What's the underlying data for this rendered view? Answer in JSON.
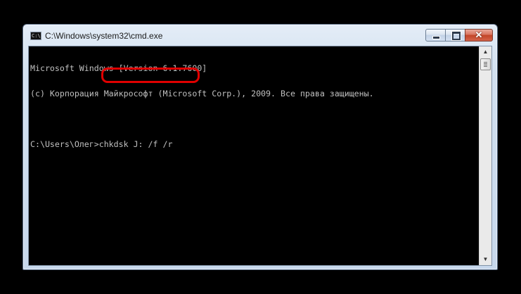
{
  "window": {
    "title": "C:\\Windows\\system32\\cmd.exe",
    "icon": "console-app-icon",
    "icon_text": "C:\\"
  },
  "caption": {
    "minimize_icon": "minimize-icon",
    "maximize_icon": "maximize-icon",
    "close_icon": "close-icon",
    "close_glyph": "✕"
  },
  "console": {
    "lines": [
      "Microsoft Windows [Version 6.1.7600]",
      "(c) Корпорация Майкрософт (Microsoft Corp.), 2009. Все права защищены.",
      "",
      "C:\\Users\\Олег>chkdsk J: /f /r"
    ],
    "highlighted_command": "chkdsk J: /f /r",
    "highlight_color": "#e00000",
    "text_color": "#c0c0c0",
    "background_color": "#000000"
  },
  "scrollbar": {
    "up_glyph": "▲",
    "down_glyph": "▼"
  }
}
